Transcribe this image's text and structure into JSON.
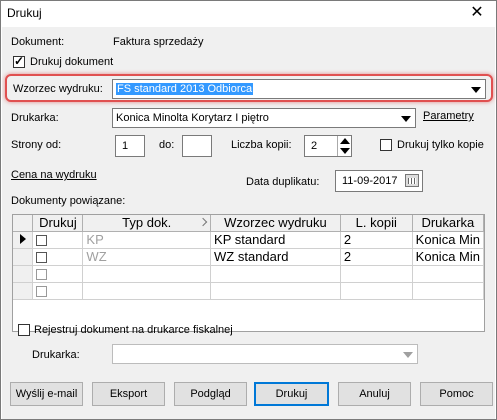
{
  "window": {
    "title": "Drukuj",
    "close_glyph": "✕"
  },
  "document": {
    "label": "Dokument:",
    "value": "Faktura sprzedaży"
  },
  "print_document": {
    "label": "Drukuj dokument",
    "checked": true
  },
  "template": {
    "label": "Wzorzec wydruku:",
    "value": "FS standard 2013 Odbiorca"
  },
  "printer": {
    "label": "Drukarka:",
    "value": "Konica Minolta Korytarz I piętro",
    "params_link": "Parametry"
  },
  "pages": {
    "from_label": "Strony od:",
    "from_value": "1",
    "to_label": "do:",
    "to_value": ""
  },
  "copies": {
    "label": "Liczba kopii:",
    "value": "2"
  },
  "only_copies": {
    "label": "Drukuj tylko kopie",
    "checked": false
  },
  "price_link": "Cena na wydruku",
  "duplicate_date": {
    "label": "Data duplikatu:",
    "value": "11-09-2017"
  },
  "related": {
    "label": "Dokumenty powiązane:",
    "columns": [
      "Drukuj",
      "Typ dok.",
      "Wzorzec wydruku",
      "L. kopii",
      "Drukarka"
    ],
    "rows": [
      {
        "type": "KP",
        "template": "KP standard",
        "copies": "2",
        "printer": "Konica Min"
      },
      {
        "type": "WZ",
        "template": "WZ standard",
        "copies": "2",
        "printer": "Konica Min"
      }
    ]
  },
  "fiscal": {
    "label": "Rejestruj dokument na drukarce fiskalnej",
    "printer_label": "Drukarka:",
    "printer_value": ""
  },
  "buttons": {
    "email": "Wyślij e-mail",
    "export": "Eksport",
    "preview": "Podgląd",
    "print": "Drukuj",
    "cancel": "Anuluj",
    "help": "Pomoc"
  }
}
